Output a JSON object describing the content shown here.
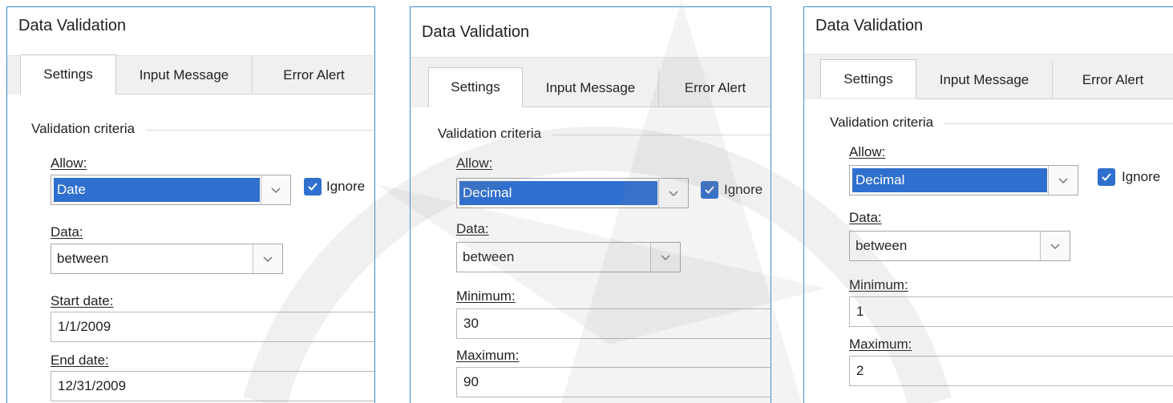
{
  "dialogs": [
    {
      "title": "Data Validation",
      "tabs": [
        "Settings",
        "Input Message",
        "Error Alert"
      ],
      "section": "Validation criteria",
      "allow_label": "Allow:",
      "allow_value": "Date",
      "ignore_label": "Ignore",
      "data_label": "Data:",
      "data_value": "between",
      "field1_label": "Start date:",
      "field1_value": "1/1/2009",
      "field2_label": "End date:",
      "field2_value": "12/31/2009"
    },
    {
      "title": "Data Validation",
      "tabs": [
        "Settings",
        "Input Message",
        "Error Alert"
      ],
      "section": "Validation criteria",
      "allow_label": "Allow:",
      "allow_value": "Decimal",
      "ignore_label": "Ignore",
      "data_label": "Data:",
      "data_value": "between",
      "field1_label": "Minimum:",
      "field1_value": "30",
      "field2_label": "Maximum:",
      "field2_value": "90"
    },
    {
      "title": "Data Validation",
      "tabs": [
        "Settings",
        "Input Message",
        "Error Alert"
      ],
      "section": "Validation criteria",
      "allow_label": "Allow:",
      "allow_value": "Decimal",
      "ignore_label": "Ignore",
      "data_label": "Data:",
      "data_value": "between",
      "field1_label": "Minimum:",
      "field1_value": "1",
      "field2_label": "Maximum:",
      "field2_value": "2"
    }
  ],
  "icons": {
    "dropdown": "chevron-down-icon",
    "checkbox": "checkmark-icon"
  },
  "colors": {
    "dialog_border": "#3a8fd6",
    "selection_highlight": "#2f6fce",
    "checkbox_fill": "#2f6fce",
    "panel_background": "#f0f0f0"
  }
}
